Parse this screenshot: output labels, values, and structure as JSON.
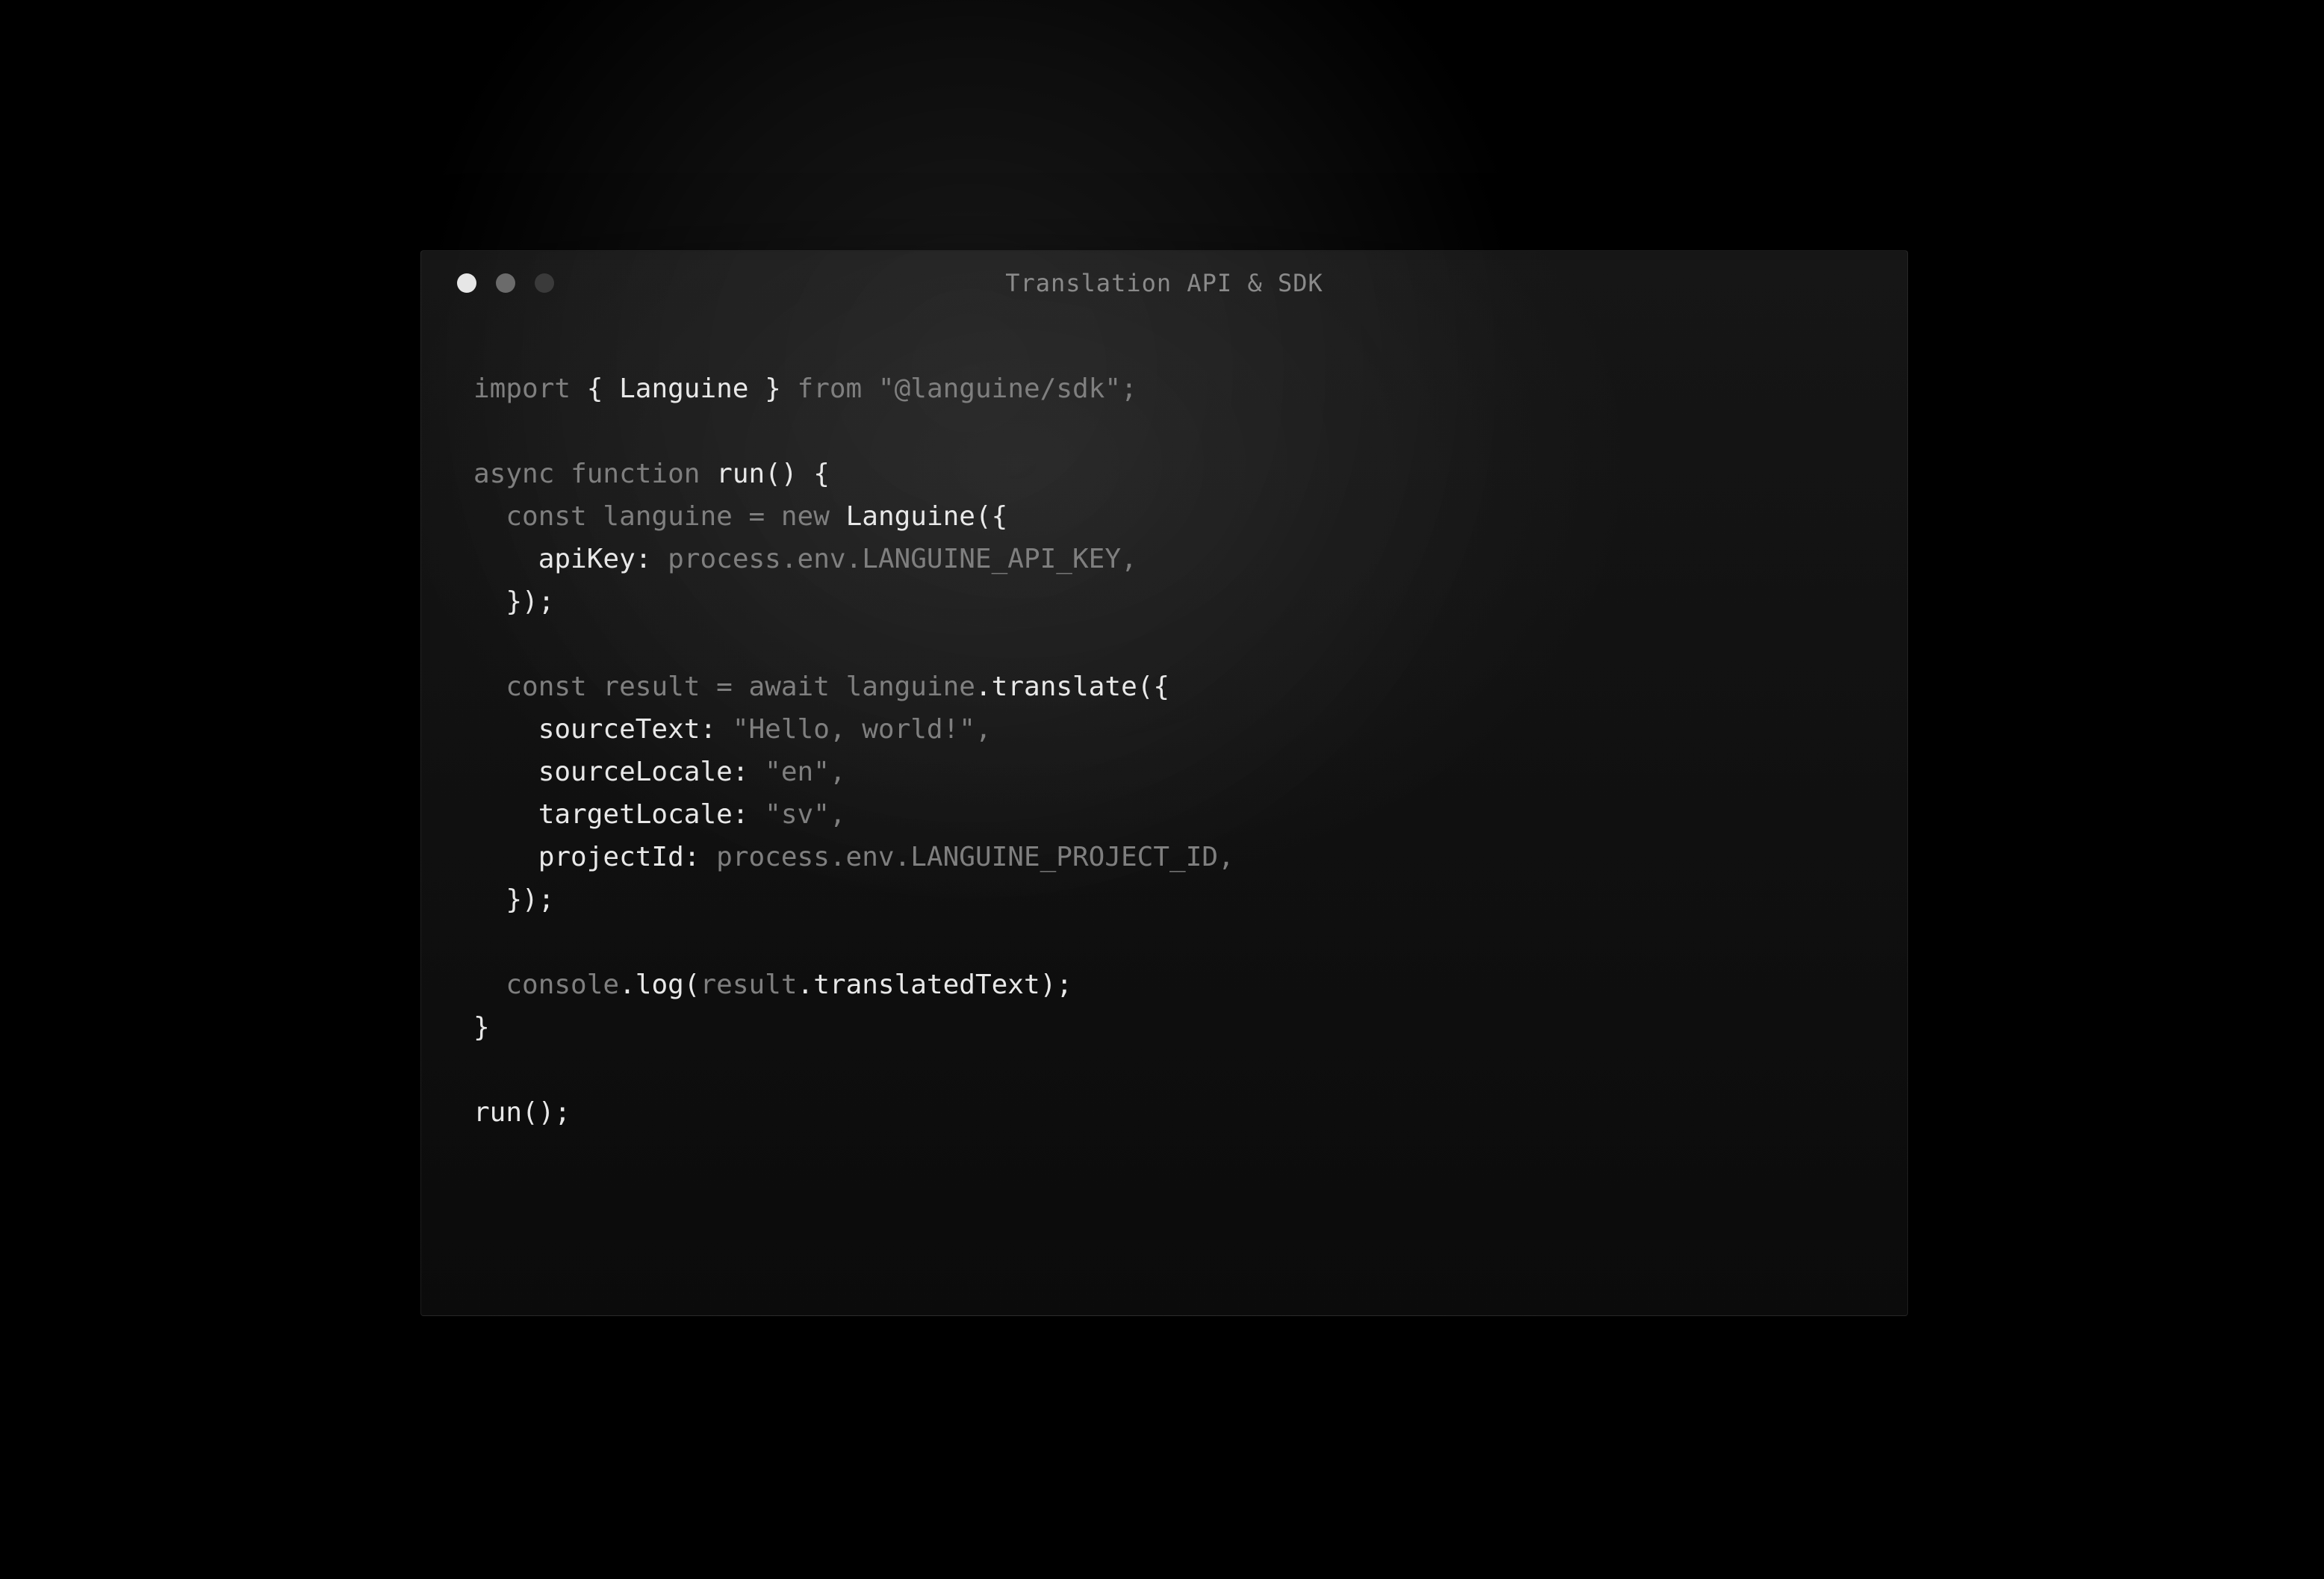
{
  "window": {
    "title": "Translation API & SDK",
    "trafficLights": {
      "close": "#e6e6e6",
      "minimize": "#6b6b6b",
      "zoom": "#3a3a3a"
    }
  },
  "code": {
    "importName": "Languine",
    "importFrom": "\"@languine/sdk\"",
    "funcDecl": "run",
    "constructor": "Languine",
    "apiKeyProp": "apiKey",
    "apiKeyVal": "process.env.LANGUINE_API_KEY",
    "translateVar": "result",
    "translateCallee": "languine",
    "translateMethod": "translate",
    "sourceTextProp": "sourceText",
    "sourceTextVal": "\"Hello, world!\"",
    "sourceLocaleProp": "sourceLocale",
    "sourceLocaleVal": "\"en\"",
    "targetLocaleProp": "targetLocale",
    "targetLocaleVal": "\"sv\"",
    "projectIdProp": "projectId",
    "projectIdVal": "process.env.LANGUINE_PROJECT_ID",
    "logObj": "console",
    "logMethod": "log",
    "logArg1": "result",
    "logArg2": "translatedText",
    "callExpr": "run"
  }
}
